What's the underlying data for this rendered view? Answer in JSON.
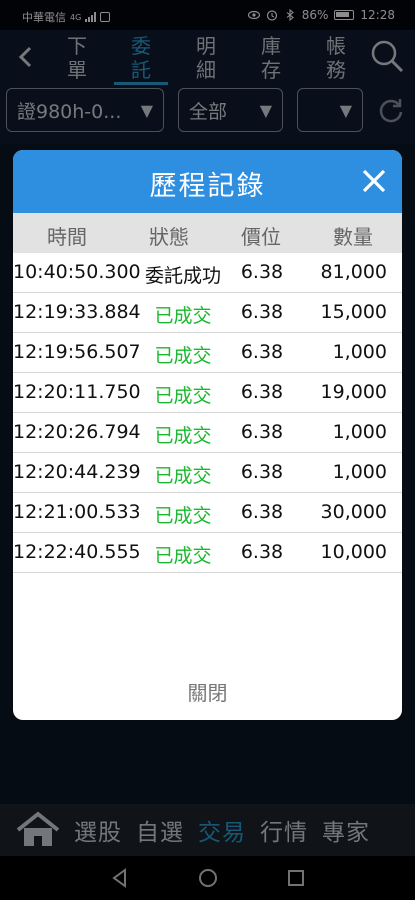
{
  "status_bar": {
    "carrier": "中華電信",
    "network": "4G",
    "battery_pct": "86%",
    "time": "12:28"
  },
  "top_nav": {
    "tabs": [
      {
        "line1": "下",
        "line2": "單",
        "active": false
      },
      {
        "line1": "委",
        "line2": "託",
        "active": true
      },
      {
        "line1": "明",
        "line2": "細",
        "active": false
      },
      {
        "line1": "庫",
        "line2": "存",
        "active": false
      },
      {
        "line1": "帳",
        "line2": "務",
        "active": false
      }
    ]
  },
  "filters": {
    "account": "證980h-0...",
    "scope": "全部",
    "third": ""
  },
  "modal": {
    "title": "歷程記錄",
    "columns": [
      "時間",
      "狀態",
      "價位",
      "數量"
    ],
    "rows": [
      {
        "time": "10:40:50.300",
        "status": "委託成功",
        "price": "6.38",
        "qty": "81,000"
      },
      {
        "time": "12:19:33.884",
        "status": "已成交",
        "price": "6.38",
        "qty": "15,000"
      },
      {
        "time": "12:19:56.507",
        "status": "已成交",
        "price": "6.38",
        "qty": "1,000"
      },
      {
        "time": "12:20:11.750",
        "status": "已成交",
        "price": "6.38",
        "qty": "19,000"
      },
      {
        "time": "12:20:26.794",
        "status": "已成交",
        "price": "6.38",
        "qty": "1,000"
      },
      {
        "time": "12:20:44.239",
        "status": "已成交",
        "price": "6.38",
        "qty": "1,000"
      },
      {
        "time": "12:21:00.533",
        "status": "已成交",
        "price": "6.38",
        "qty": "30,000"
      },
      {
        "time": "12:22:40.555",
        "status": "已成交",
        "price": "6.38",
        "qty": "10,000"
      }
    ],
    "close_label": "關閉"
  },
  "bottom_nav": {
    "items": [
      "選股",
      "自選",
      "交易",
      "行情",
      "專家"
    ],
    "active": "交易"
  },
  "colors": {
    "accent": "#2aa1d7",
    "modal_header": "#2e8fe0",
    "filled_status": "#1ab82e"
  },
  "icons": [
    "back-arrow-icon",
    "search-icon",
    "refresh-icon",
    "close-icon",
    "home-icon",
    "android-back-icon",
    "android-home-icon",
    "android-recents-icon"
  ]
}
